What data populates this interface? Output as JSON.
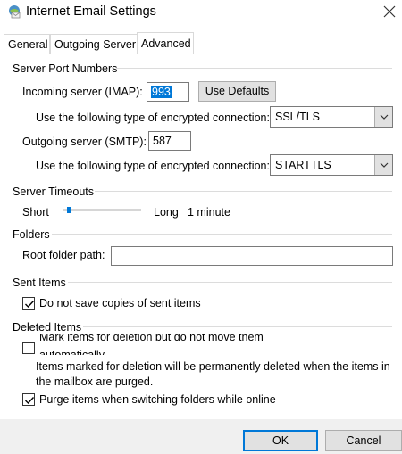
{
  "window": {
    "title": "Internet Email Settings"
  },
  "tabs": [
    {
      "label": "General"
    },
    {
      "label": "Outgoing Server"
    },
    {
      "label": "Advanced"
    }
  ],
  "server_ports": {
    "heading": "Server Port Numbers",
    "incoming_label": "Incoming server (IMAP):",
    "incoming_value": "993",
    "use_defaults": "Use Defaults",
    "enc_label_1": "Use the following type of encrypted connection:",
    "enc_value_1": "SSL/TLS",
    "outgoing_label": "Outgoing server (SMTP):",
    "outgoing_value": "587",
    "enc_label_2": "Use the following type of encrypted connection:",
    "enc_value_2": "STARTTLS"
  },
  "timeouts": {
    "heading": "Server Timeouts",
    "short": "Short",
    "long": "Long",
    "value": "1 minute",
    "slider_fraction": 0.05
  },
  "folders": {
    "heading": "Folders",
    "root_label": "Root folder path:",
    "root_value": ""
  },
  "sent": {
    "heading": "Sent Items",
    "dont_save_label": "Do not save copies of sent items",
    "dont_save_checked": true
  },
  "deleted": {
    "heading": "Deleted Items",
    "mark_label_line1": "Mark items for deletion but do not move them",
    "mark_label_line2": "automatically",
    "mark_checked": false,
    "info_line1": "Items marked for deletion will be permanently deleted when the items in",
    "info_line2": "the mailbox are purged.",
    "purge_label": "Purge items when switching folders while online",
    "purge_checked": true
  },
  "footer": {
    "ok": "OK",
    "cancel": "Cancel"
  },
  "colors": {
    "accent": "#0078d7",
    "button_face": "#e1e1e1",
    "footer_bg": "#f0f0f0"
  },
  "icons": {
    "title": "outlook-globe-envelope-icon",
    "close": "close-icon",
    "dropdown": "chevron-down-icon",
    "check": "checkmark-icon"
  }
}
